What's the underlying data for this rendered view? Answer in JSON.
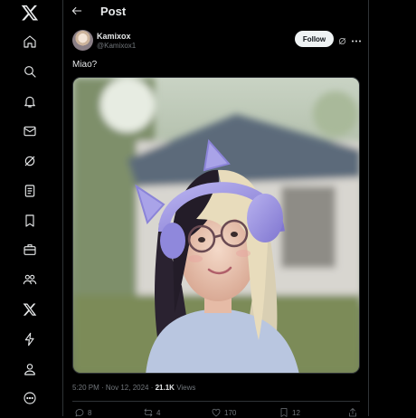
{
  "sidebar": {
    "items": [
      {
        "icon": "x-logo-icon"
      },
      {
        "icon": "home-icon"
      },
      {
        "icon": "search-icon"
      },
      {
        "icon": "bell-icon"
      },
      {
        "icon": "mail-icon"
      },
      {
        "icon": "grok-icon"
      },
      {
        "icon": "lists-icon"
      },
      {
        "icon": "bookmark-icon"
      },
      {
        "icon": "briefcase-icon"
      },
      {
        "icon": "communities-icon"
      },
      {
        "icon": "x-premium-icon"
      },
      {
        "icon": "lightning-icon"
      },
      {
        "icon": "profile-icon"
      },
      {
        "icon": "more-circle-icon"
      }
    ]
  },
  "header": {
    "title": "Post"
  },
  "post": {
    "author": {
      "name": "Kamixox",
      "handle": "@Kamixox1"
    },
    "follow_label": "Follow",
    "text": "Miao?",
    "time": "5:20 PM · Nov 12, 2024 · ",
    "views_count": "21.1K",
    "views_label": " Views",
    "actions": {
      "replies": "8",
      "reposts": "4",
      "likes": "170",
      "bookmarks": "12"
    }
  },
  "colors": {
    "background": "#000000",
    "text": "#e7e9ea",
    "muted": "#71767b",
    "border": "#2f3336",
    "follow_bg": "#eff3f4"
  }
}
